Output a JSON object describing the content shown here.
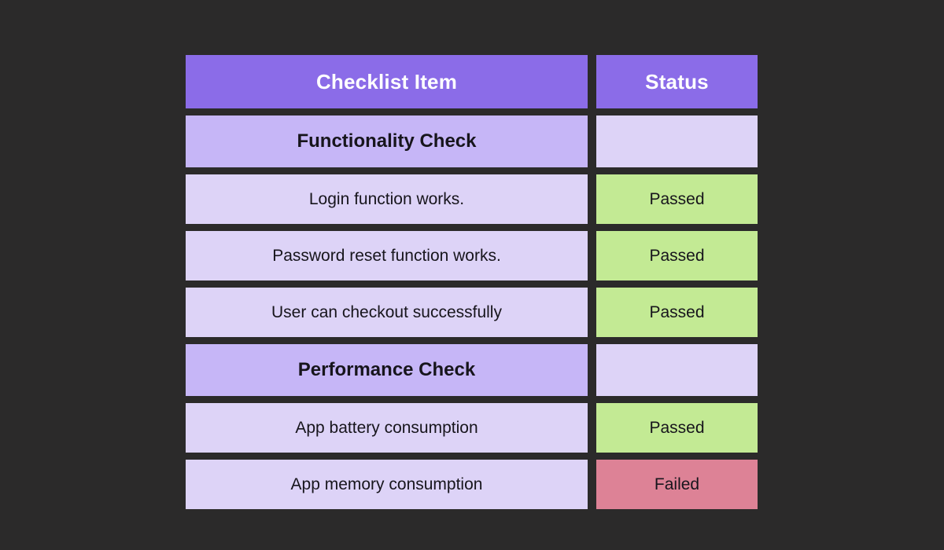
{
  "theme": {
    "background": "#2b2a2a",
    "header_bg": "#8b6ce8",
    "header_text": "#ffffff",
    "section_bg": "#c6b6f7",
    "row_bg": "#ddd3f7",
    "passed_bg": "#c3ea94",
    "failed_bg": "#dd8296",
    "text": "#17151c"
  },
  "table": {
    "headers": {
      "item": "Checklist Item",
      "status": "Status"
    },
    "rows": [
      {
        "type": "section",
        "item": "Functionality Check",
        "status": "",
        "status_state": "empty"
      },
      {
        "type": "item",
        "item": "Login function works.",
        "status": "Passed",
        "status_state": "passed"
      },
      {
        "type": "item",
        "item": "Password reset function works.",
        "status": "Passed",
        "status_state": "passed"
      },
      {
        "type": "item",
        "item": "User can checkout successfully",
        "status": "Passed",
        "status_state": "passed"
      },
      {
        "type": "section",
        "item": "Performance Check",
        "status": "",
        "status_state": "empty"
      },
      {
        "type": "item",
        "item": "App battery consumption",
        "status": "Passed",
        "status_state": "passed"
      },
      {
        "type": "item",
        "item": "App memory consumption",
        "status": "Failed",
        "status_state": "failed"
      }
    ]
  }
}
